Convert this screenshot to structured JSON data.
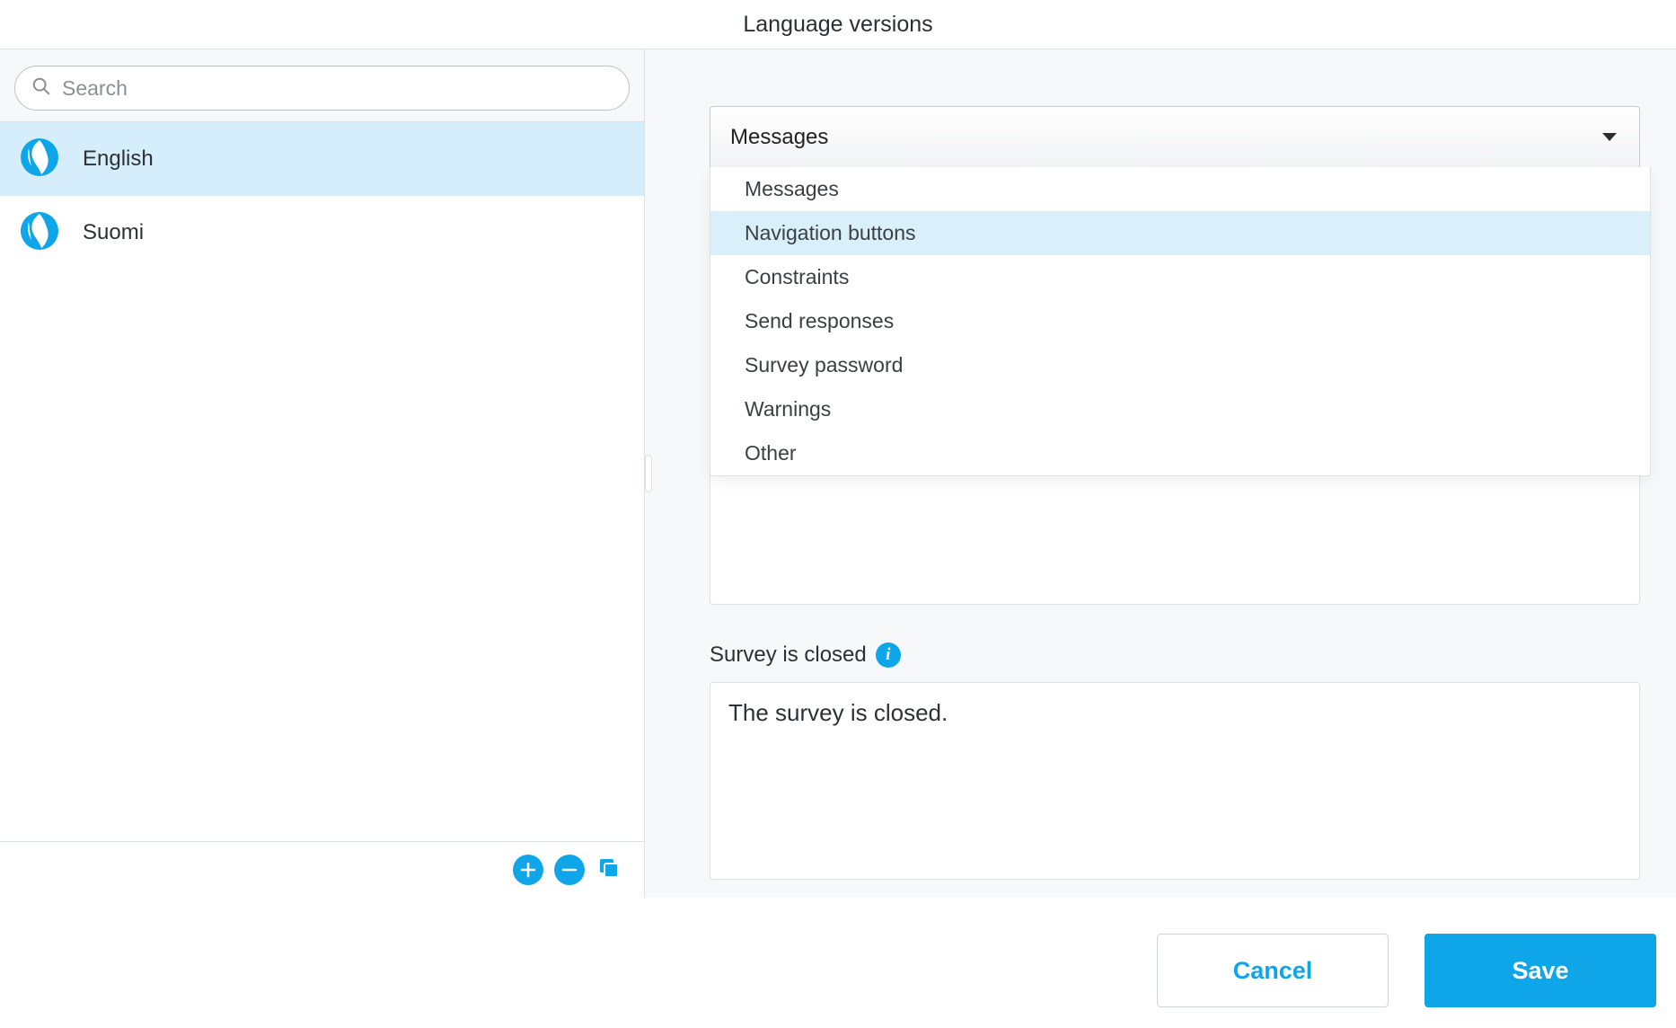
{
  "title": "Language versions",
  "search": {
    "placeholder": "Search"
  },
  "languages": [
    {
      "label": "English",
      "selected": true
    },
    {
      "label": "Suomi",
      "selected": false
    }
  ],
  "dropdown": {
    "selected_label": "Messages",
    "options": [
      {
        "label": "Messages",
        "highlight": false
      },
      {
        "label": "Navigation buttons",
        "highlight": true
      },
      {
        "label": "Constraints",
        "highlight": false
      },
      {
        "label": "Send responses",
        "highlight": false
      },
      {
        "label": "Survey password",
        "highlight": false
      },
      {
        "label": "Warnings",
        "highlight": false
      },
      {
        "label": "Other",
        "highlight": false
      }
    ]
  },
  "field_closed": {
    "label": "Survey is closed",
    "value": "The survey is closed."
  },
  "footer": {
    "cancel": "Cancel",
    "save": "Save"
  }
}
